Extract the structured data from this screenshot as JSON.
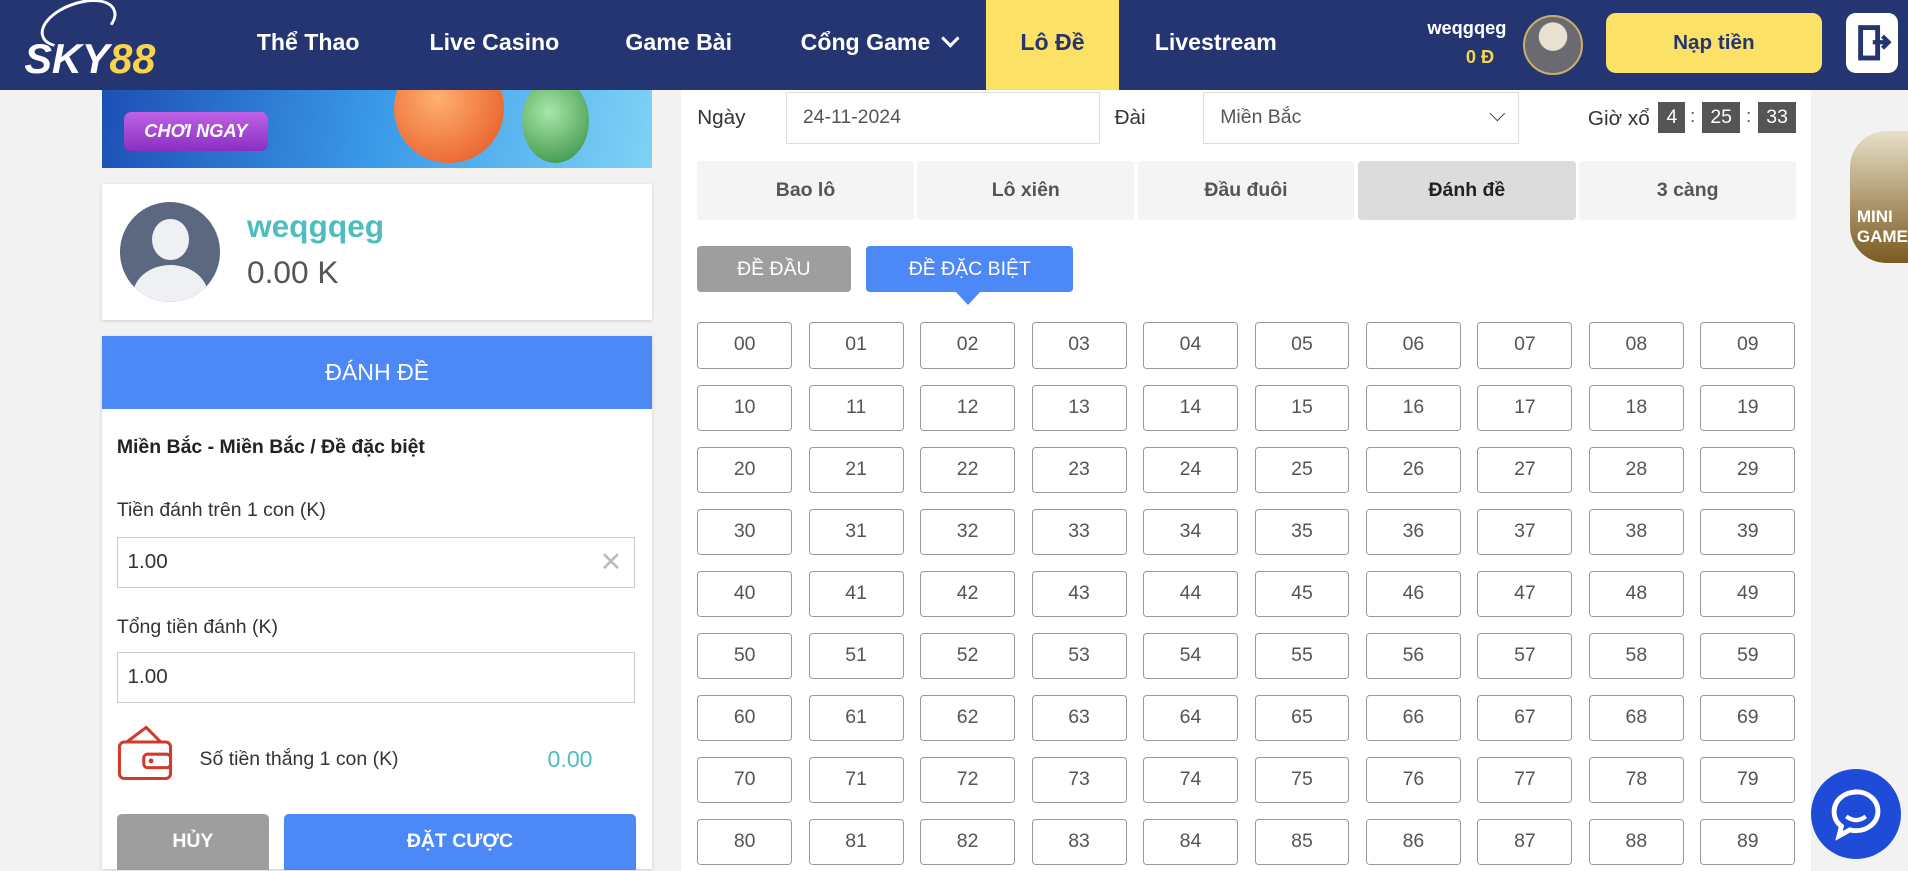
{
  "brand": {
    "logo_text": "SKY88",
    "primary": "#253572",
    "accent": "#fbe165",
    "blue": "#4d88f7",
    "teal": "#4fbcc0"
  },
  "nav": {
    "items": [
      {
        "label": "Thể Thao"
      },
      {
        "label": "Live Casino"
      },
      {
        "label": "Game Bài"
      },
      {
        "label": "Cổng Game"
      },
      {
        "label": "Lô Đề",
        "active": true
      },
      {
        "label": "Livestream"
      }
    ]
  },
  "account": {
    "username": "weqgqeg",
    "balance": "0 Đ",
    "topup_label": "Nạp tiền"
  },
  "banner": {
    "cta": "CHƠI NGAY"
  },
  "profile": {
    "name": "weqgqeg",
    "balance": "0.00 K"
  },
  "bet": {
    "header": "ĐÁNH ĐỀ",
    "title": "Miền Bắc - Miền Bắc / Đề đặc biệt",
    "stake_label": "Tiền đánh trên 1 con (K)",
    "stake_value": "1.00",
    "total_label": "Tổng tiền đánh (K)",
    "total_value": "1.00",
    "win_label": "Số tiền thắng 1 con (K)",
    "win_value": "0.00",
    "cancel_label": "HỦY",
    "place_label": "ĐẶT CƯỢC"
  },
  "filters": {
    "date_label": "Ngày",
    "date_value": "24-11-2024",
    "station_label": "Đài",
    "station_value": "Miền Bắc",
    "draw_label": "Giờ xổ",
    "countdown": [
      "4",
      "25",
      "33"
    ],
    "sep": ":"
  },
  "tabs": [
    {
      "label": "Bao lô"
    },
    {
      "label": "Lô xiên"
    },
    {
      "label": "Đầu đuôi"
    },
    {
      "label": "Đánh đề",
      "active": true
    },
    {
      "label": "3 càng"
    }
  ],
  "subtabs": [
    {
      "label": "ĐỀ ĐẦU"
    },
    {
      "label": "ĐỀ ĐẶC BIỆT",
      "active": true
    }
  ],
  "numbers": [
    "00",
    "01",
    "02",
    "03",
    "04",
    "05",
    "06",
    "07",
    "08",
    "09",
    "10",
    "11",
    "12",
    "13",
    "14",
    "15",
    "16",
    "17",
    "18",
    "19",
    "20",
    "21",
    "22",
    "23",
    "24",
    "25",
    "26",
    "27",
    "28",
    "29",
    "30",
    "31",
    "32",
    "33",
    "34",
    "35",
    "36",
    "37",
    "38",
    "39",
    "40",
    "41",
    "42",
    "43",
    "44",
    "45",
    "46",
    "47",
    "48",
    "49",
    "50",
    "51",
    "52",
    "53",
    "54",
    "55",
    "56",
    "57",
    "58",
    "59",
    "60",
    "61",
    "62",
    "63",
    "64",
    "65",
    "66",
    "67",
    "68",
    "69",
    "70",
    "71",
    "72",
    "73",
    "74",
    "75",
    "76",
    "77",
    "78",
    "79",
    "80",
    "81",
    "82",
    "83",
    "84",
    "85",
    "86",
    "87",
    "88",
    "89"
  ],
  "widgets": {
    "mini_game": "MINI GAME"
  }
}
